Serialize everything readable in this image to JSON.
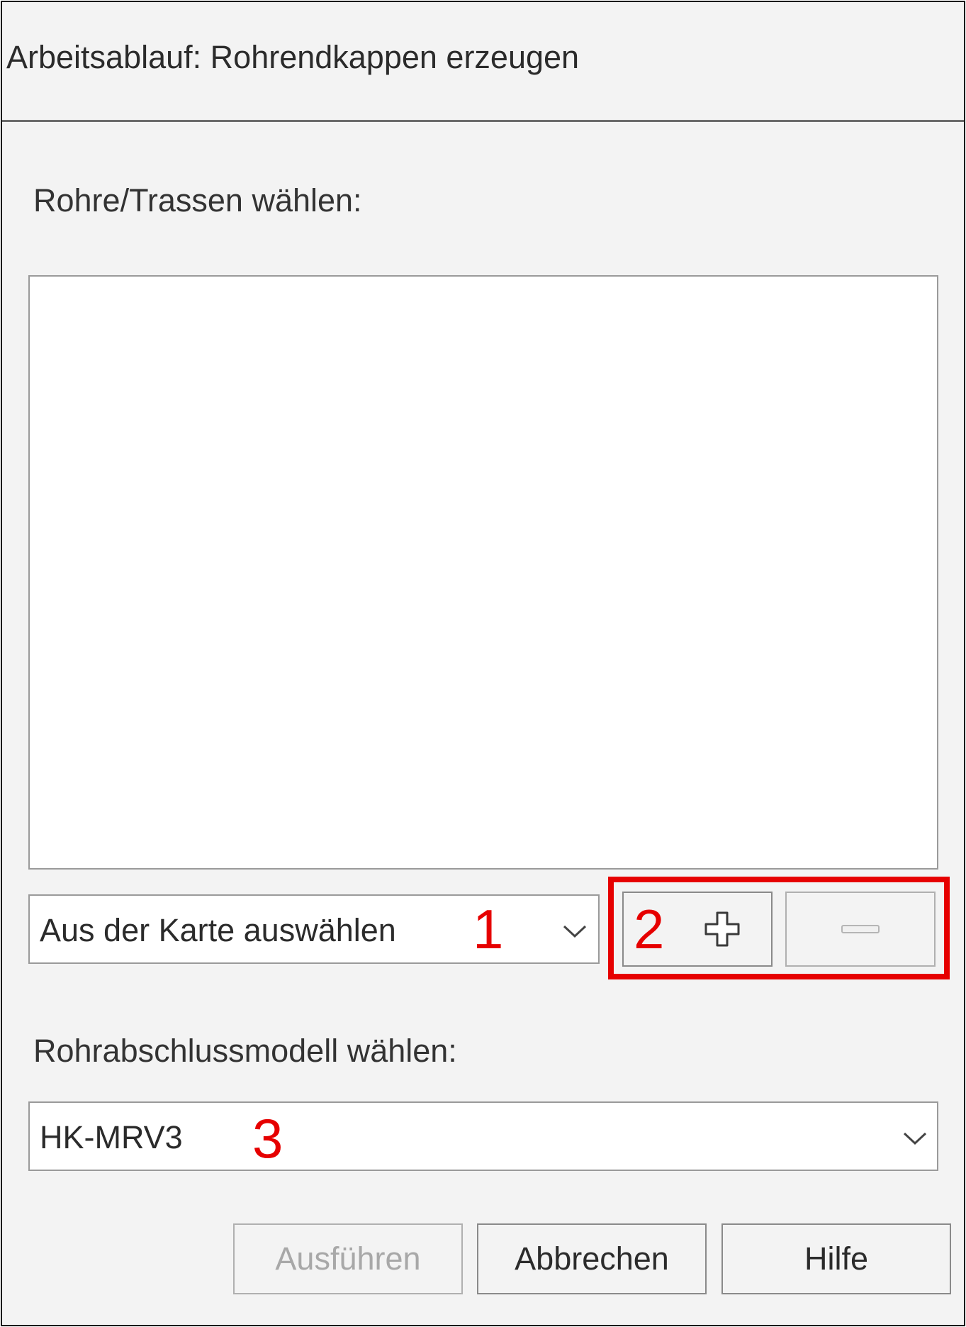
{
  "dialog": {
    "title": "Arbeitsablauf: Rohrendkappen erzeugen"
  },
  "pipes": {
    "label": "Rohre/Trassen wählen:",
    "items": [],
    "source_select": {
      "value": "Aus der Karte auswählen"
    }
  },
  "model": {
    "label": "Rohrabschlussmodell wählen:",
    "value": "HK-MRV3"
  },
  "buttons": {
    "run": "Ausführen",
    "cancel": "Abbrechen",
    "help": "Hilfe"
  },
  "callouts": {
    "one": "1",
    "two": "2",
    "three": "3"
  },
  "colors": {
    "annotation": "#e60000",
    "background": "#f3f3f3",
    "disabled_text": "#a8a8a8"
  },
  "icons": {
    "add": "plus-icon",
    "remove": "minus-icon",
    "dropdown": "chevron-down-icon"
  }
}
